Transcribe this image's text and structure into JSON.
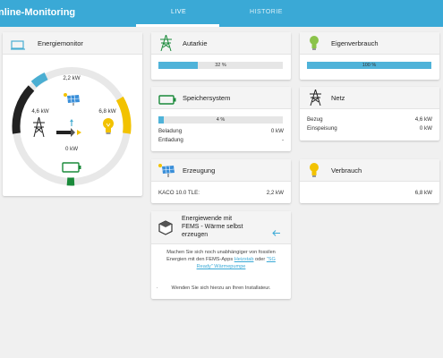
{
  "header": {
    "app_title": "nline-Monitoring",
    "tabs": [
      {
        "label": "LIVE",
        "active": true
      },
      {
        "label": "HISTORIE",
        "active": false
      }
    ]
  },
  "energiemonitor": {
    "title": "Energiemonitor",
    "production_value": "2,2 kW",
    "grid_value": "4,6 kW",
    "consumption_value": "6,8 kW",
    "storage_value": "0 kW"
  },
  "autarkie": {
    "title": "Autarkie",
    "percent_label": "32 %",
    "percent": 32
  },
  "eigenverbrauch": {
    "title": "Eigenverbrauch",
    "percent_label": "100 %",
    "percent": 100
  },
  "speichersystem": {
    "title": "Speichersystem",
    "percent_label": "4 %",
    "percent": 4,
    "rows": [
      {
        "label": "Beladung",
        "value": "0 kW"
      },
      {
        "label": "Entladung",
        "value": "-"
      }
    ]
  },
  "netz": {
    "title": "Netz",
    "rows": [
      {
        "label": "Bezug",
        "value": "4,6 kW"
      },
      {
        "label": "Einspeisung",
        "value": "0 kW"
      }
    ]
  },
  "erzeugung": {
    "title": "Erzeugung",
    "rows": [
      {
        "label": "KACO 10.0 TLE:",
        "value": "2,2 kW"
      }
    ]
  },
  "verbrauch": {
    "title": "Verbrauch",
    "value": "6,8 kW"
  },
  "energiewende": {
    "title_line1": "Energiewende mit",
    "title_line2": "FEMS - Wärme selbst",
    "title_line3": "erzeugen",
    "text_line1": "Machen Sie sich noch unabhängiger von fossilen",
    "text_line2a": "Energien mit den FEMS-Apps ",
    "link_heizstab": "Heizstab",
    "text_line2b": " oder ",
    "link_sg_ready_line1": "\"SG",
    "link_sg_ready_line2": "Ready\" Wärmepumpe",
    "text_line4": "Wenden Sie sich hierzu an Ihren Installateur.",
    "bullet": "."
  },
  "colors": {
    "accent": "#3aa9d6",
    "bar_fill": "#4fb3d9",
    "yellow": "#f2c200",
    "green": "#1a8a3a",
    "dark": "#222222",
    "lightblue": "#4aaed2"
  }
}
